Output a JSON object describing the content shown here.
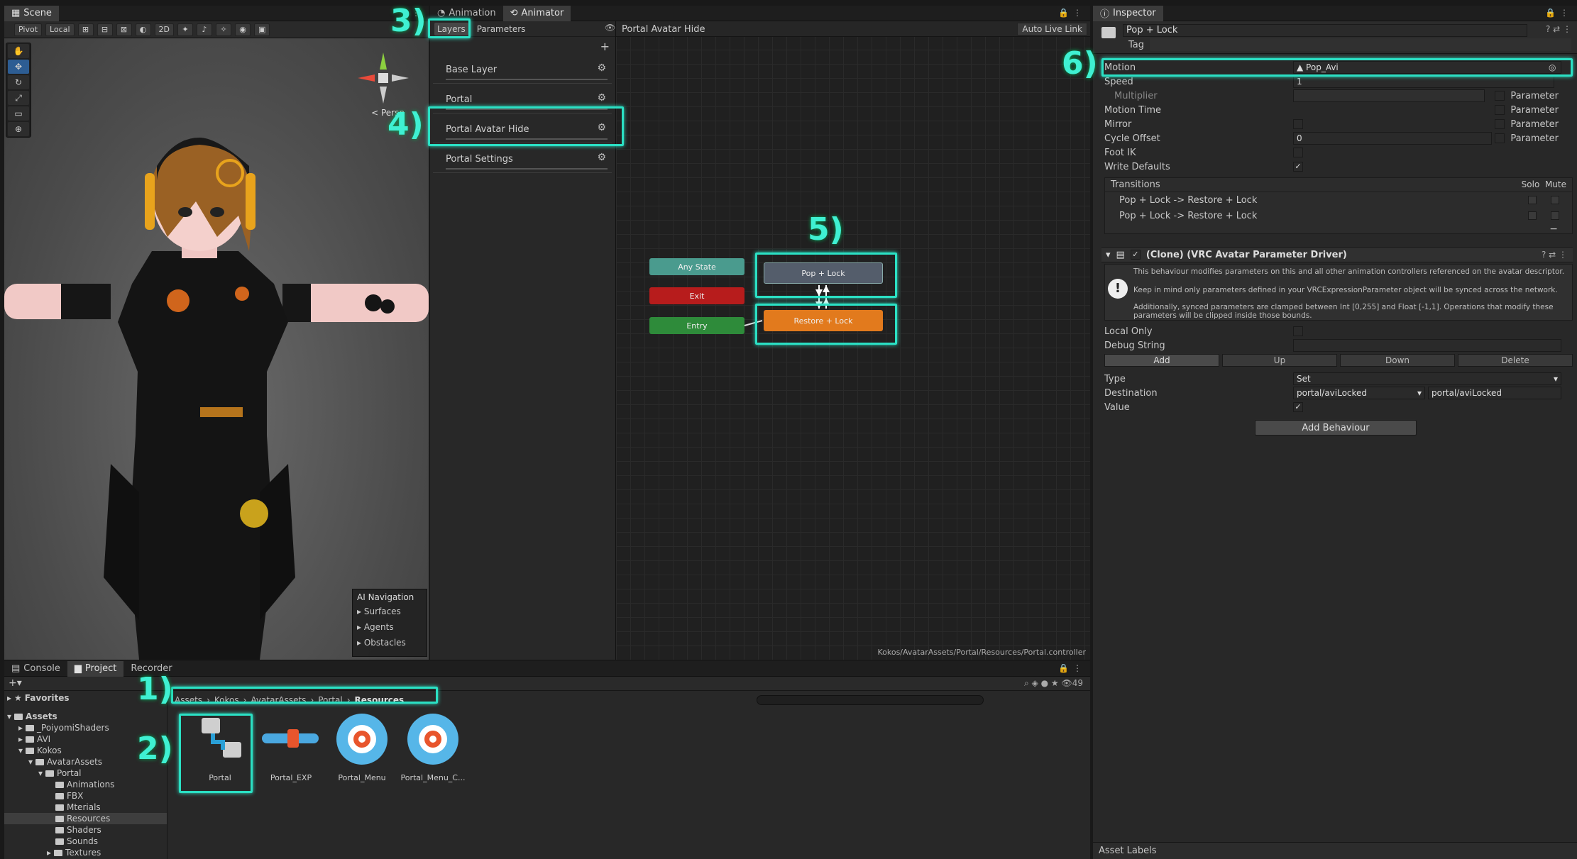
{
  "scene": {
    "tab": "Scene",
    "toolbar": {
      "pivot": "Pivot",
      "local": "Local",
      "mode2d": "2D"
    },
    "persp": "< Persp",
    "ai_nav": {
      "title": "AI Navigation",
      "items": [
        "Surfaces",
        "Agents",
        "Obstacles"
      ]
    }
  },
  "animator": {
    "tabs": [
      "Animation",
      "Animator"
    ],
    "layer_tabs": {
      "layers": "Layers",
      "parameters": "Parameters"
    },
    "layers": [
      "Base Layer",
      "Portal",
      "Portal Avatar Hide",
      "Portal Settings"
    ],
    "breadcrumb": "Portal Avatar Hide",
    "live_link": "Auto Live Link",
    "nodes": {
      "any_state": "Any State",
      "exit": "Exit",
      "entry": "Entry",
      "pop_lock": "Pop + Lock",
      "restore_lock": "Restore + Lock"
    },
    "path": "Kokos/AvatarAssets/Portal/Resources/Portal.controller"
  },
  "inspector": {
    "tab": "Inspector",
    "name": "Pop + Lock",
    "tag_label": "Tag",
    "motion": {
      "label": "Motion",
      "value": "Pop_Avi"
    },
    "speed": {
      "label": "Speed",
      "value": "1"
    },
    "multiplier": "Multiplier",
    "motion_time": "Motion Time",
    "mirror": "Mirror",
    "cycle_offset": {
      "label": "Cycle Offset",
      "value": "0"
    },
    "foot_ik": "Foot IK",
    "write_defaults": "Write Defaults",
    "parameter": "Parameter",
    "transitions": {
      "title": "Transitions",
      "solo": "Solo",
      "mute": "Mute",
      "rows": [
        "Pop + Lock -> Restore + Lock",
        "Pop + Lock -> Restore + Lock"
      ]
    },
    "component": "(Clone) (VRC Avatar Parameter Driver)",
    "help": [
      "This behaviour modifies parameters on this and all other animation controllers referenced on the avatar descriptor.",
      "Keep in mind only parameters defined in your VRCExpressionParameter object will be synced across the network.",
      "Additionally, synced parameters are clamped between Int [0,255] and Float [-1,1]. Operations that modify these parameters will be clipped inside those bounds."
    ],
    "local_only": "Local Only",
    "debug_string": "Debug String",
    "buttons": [
      "Add",
      "Up",
      "Down",
      "Delete"
    ],
    "type": {
      "label": "Type",
      "value": "Set"
    },
    "destination": {
      "label": "Destination",
      "value": "portal/aviLocked",
      "text": "portal/aviLocked"
    },
    "value_label": "Value",
    "add_behaviour": "Add Behaviour",
    "asset_labels": "Asset Labels"
  },
  "project": {
    "tabs": [
      "Console",
      "Project",
      "Recorder"
    ],
    "favorites": "Favorites",
    "tree": [
      {
        "label": "Assets",
        "depth": 0
      },
      {
        "label": "_PoiyomiShaders",
        "depth": 1
      },
      {
        "label": "AVI",
        "depth": 1
      },
      {
        "label": "Kokos",
        "depth": 1
      },
      {
        "label": "AvatarAssets",
        "depth": 2
      },
      {
        "label": "Portal",
        "depth": 3
      },
      {
        "label": "Animations",
        "depth": 4
      },
      {
        "label": "FBX",
        "depth": 4
      },
      {
        "label": "Mterials",
        "depth": 4
      },
      {
        "label": "Resources",
        "depth": 4
      },
      {
        "label": "Shaders",
        "depth": 4
      },
      {
        "label": "Sounds",
        "depth": 4
      },
      {
        "label": "Textures",
        "depth": 4
      }
    ],
    "breadcrumb": [
      "Assets",
      "Kokos",
      "AvatarAssets",
      "Portal",
      "Resources"
    ],
    "assets": [
      "Portal",
      "Portal_EXP",
      "Portal_Menu",
      "Portal_Menu_C..."
    ],
    "count": "49"
  },
  "annotations": [
    "1)",
    "2)",
    "3)",
    "4)",
    "5)",
    "6)"
  ],
  "colors": {
    "highlight": "#2be0c4",
    "any_state": "#4a9b8e",
    "exit": "#b71c1c",
    "entry": "#2e8b3a",
    "restore": "#e27a1d",
    "pop": "#545d6b"
  }
}
